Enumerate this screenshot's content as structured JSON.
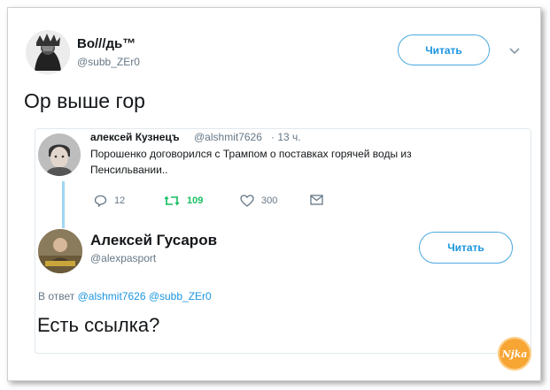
{
  "main_tweet": {
    "author_name": "Во///дь™",
    "handle": "@subb_ZEr0",
    "follow_label": "Читать",
    "text": "Ор выше гор"
  },
  "quoted_tweet": {
    "author_name": "алексей Кузнецъ",
    "handle": "@alshmit7626",
    "time": "· 13 ч.",
    "text_line1": "Порошенко договорился с Трампом о поставках горячей воды из",
    "text_line2": "Пенсильвании..",
    "actions": {
      "replies": "12",
      "retweets": "109",
      "likes": "300"
    }
  },
  "reply_tweet": {
    "author_name": "Алексей Гусаров",
    "handle": "@alexpasport",
    "follow_label": "Читать",
    "reply_prefix": "В ответ",
    "reply_mentions": "@alshmit7626 @subb_ZEr0",
    "text": "Есть ссылка?"
  },
  "watermark": {
    "label": "Njka"
  },
  "colors": {
    "accent": "#1b95e0",
    "retweet_green": "#17bf63",
    "thread_line": "#9fd6f2",
    "secondary_text": "#657786"
  }
}
